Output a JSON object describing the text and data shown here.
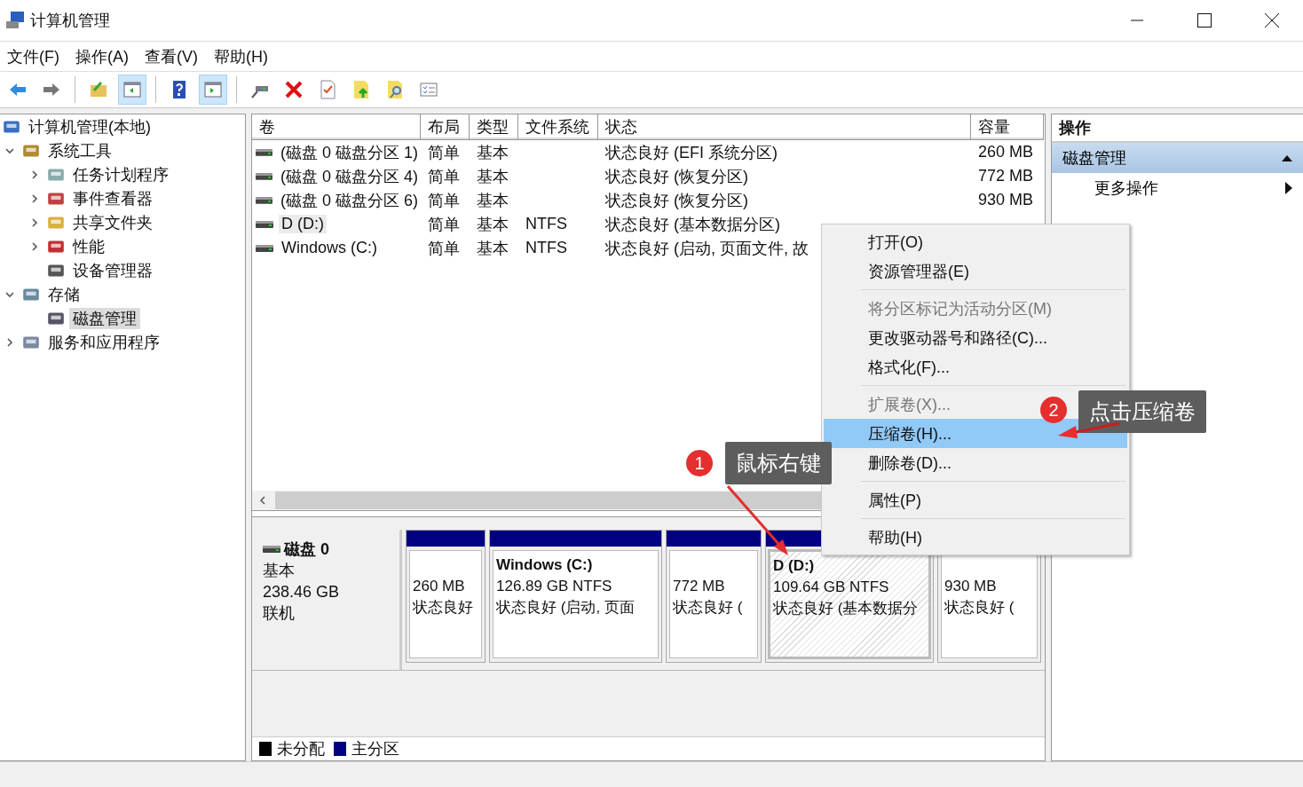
{
  "window": {
    "title": "计算机管理"
  },
  "menubar": [
    "文件(F)",
    "操作(A)",
    "查看(V)",
    "帮助(H)"
  ],
  "toolbar": [
    {
      "pressed": false
    },
    {
      "pressed": false
    },
    {
      "pressed": false
    },
    {
      "pressed": true
    },
    {
      "pressed": false
    },
    {
      "pressed": true
    },
    {
      "pressed": false
    },
    {
      "pressed": false
    },
    {
      "pressed": false
    },
    {
      "pressed": false
    },
    {
      "pressed": false
    },
    {
      "pressed": false
    }
  ],
  "tree": [
    {
      "label": "计算机管理(本地)",
      "selected": false,
      "children": [
        {
          "label": "系统工具",
          "selected": false,
          "expanded": true,
          "children": [
            {
              "label": "任务计划程序",
              "selected": false,
              "expanded": false
            },
            {
              "label": "事件查看器",
              "selected": false,
              "expanded": false
            },
            {
              "label": "共享文件夹",
              "selected": false,
              "expanded": false
            },
            {
              "label": "性能",
              "selected": false,
              "expanded": false
            },
            {
              "label": "设备管理器",
              "selected": false
            }
          ]
        },
        {
          "label": "存储",
          "selected": false,
          "expanded": true,
          "children": [
            {
              "label": "磁盘管理",
              "selected": true
            }
          ]
        },
        {
          "label": "服务和应用程序",
          "selected": false,
          "expanded": false
        }
      ]
    }
  ],
  "table": {
    "columns": [
      "卷",
      "布局",
      "类型",
      "文件系统",
      "状态",
      "容量"
    ],
    "rows": [
      {
        "selected": false,
        "cells": [
          "(磁盘 0 磁盘分区 1)",
          "简单",
          "基本",
          "",
          "状态良好 (EFI 系统分区)",
          "260 MB"
        ]
      },
      {
        "selected": false,
        "cells": [
          "(磁盘 0 磁盘分区 4)",
          "简单",
          "基本",
          "",
          "状态良好 (恢复分区)",
          "772 MB"
        ]
      },
      {
        "selected": false,
        "cells": [
          "(磁盘 0 磁盘分区 6)",
          "简单",
          "基本",
          "",
          "状态良好 (恢复分区)",
          "930 MB"
        ]
      },
      {
        "selected": true,
        "cells": [
          "D (D:)",
          "简单",
          "基本",
          "NTFS",
          "状态良好 (基本数据分区)",
          ""
        ]
      },
      {
        "selected": false,
        "cells": [
          "Windows  (C:)",
          "简单",
          "基本",
          "NTFS",
          "状态良好 (启动, 页面文件, 故",
          ""
        ]
      }
    ]
  },
  "disk": {
    "name": "磁盘 0",
    "type": "基本",
    "size": "238.46 GB",
    "status": "联机",
    "partitions": [
      {
        "selected": false,
        "lines": [
          "260 MB",
          "状态良好"
        ]
      },
      {
        "selected": false,
        "title": "Windows   (C:)",
        "lines": [
          "126.89 GB NTFS",
          "状态良好 (启动, 页面"
        ]
      },
      {
        "selected": false,
        "lines": [
          "772 MB",
          "状态良好 ("
        ]
      },
      {
        "selected": true,
        "title": "D (D:)",
        "lines": [
          "109.64 GB NTFS",
          "状态良好 (基本数据分"
        ]
      },
      {
        "selected": false,
        "lines": [
          "930 MB",
          "状态良好 ("
        ]
      }
    ]
  },
  "legend": [
    {
      "label": "未分配",
      "color": "#000000"
    },
    {
      "label": "主分区",
      "color": "#000080"
    }
  ],
  "actions": {
    "title": "操作",
    "section": {
      "label": "磁盘管理",
      "expanded": true
    },
    "items": [
      "更多操作"
    ]
  },
  "context_menu": [
    {
      "kind": "item",
      "label": "打开(O)",
      "disabled": false,
      "selected": false
    },
    {
      "kind": "item",
      "label": "资源管理器(E)",
      "disabled": false,
      "selected": false
    },
    {
      "kind": "separator"
    },
    {
      "kind": "item",
      "label": "将分区标记为活动分区(M)",
      "disabled": true,
      "selected": false
    },
    {
      "kind": "item",
      "label": "更改驱动器号和路径(C)...",
      "disabled": false,
      "selected": false
    },
    {
      "kind": "item",
      "label": "格式化(F)...",
      "disabled": false,
      "selected": false
    },
    {
      "kind": "separator"
    },
    {
      "kind": "item",
      "label": "扩展卷(X)...",
      "disabled": true,
      "selected": false
    },
    {
      "kind": "item",
      "label": "压缩卷(H)...",
      "disabled": false,
      "selected": true
    },
    {
      "kind": "item",
      "label": "删除卷(D)...",
      "disabled": false,
      "selected": false
    },
    {
      "kind": "separator"
    },
    {
      "kind": "item",
      "label": "属性(P)",
      "disabled": false,
      "selected": false
    },
    {
      "kind": "separator"
    },
    {
      "kind": "item",
      "label": "帮助(H)",
      "disabled": false,
      "selected": false
    }
  ],
  "annotations": [
    {
      "number": "1",
      "text": "鼠标右键"
    },
    {
      "number": "2",
      "text": "点击压缩卷"
    }
  ]
}
